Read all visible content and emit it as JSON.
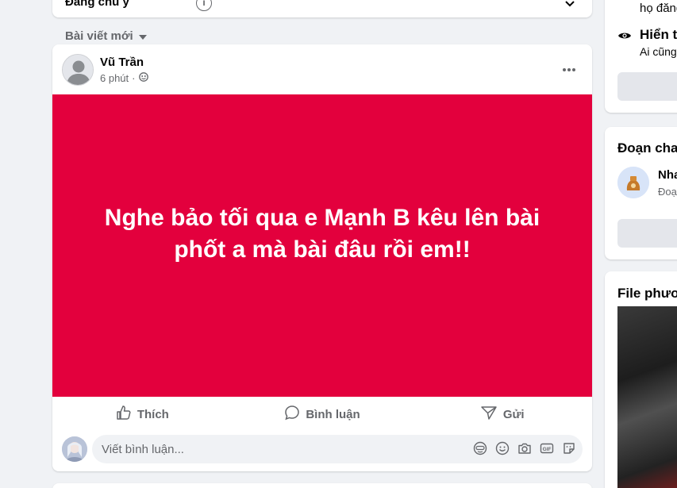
{
  "feed": {
    "top_card_label": "Đáng chú ý",
    "sort_label": "Bài viết mới"
  },
  "post": {
    "author": "Vũ Trần",
    "time": "6 phút",
    "separator": "·",
    "content": "Nghe bảo tối qua e Mạnh B kêu lên bài phốt a mà bài đâu rồi em!!",
    "background_color": "#e3003d",
    "actions": [
      {
        "label": "Thích",
        "icon": "like-icon"
      },
      {
        "label": "Bình luận",
        "icon": "comment-icon"
      },
      {
        "label": "Gửi",
        "icon": "send-icon"
      }
    ],
    "comment_placeholder": "Viết bình luận..."
  },
  "right": {
    "card1": {
      "sub1": "họ đăng",
      "title": "Hiển t",
      "sub2": "Ai cũng"
    },
    "card2": {
      "title": "Đoạn chat",
      "chat_name": "Nha",
      "chat_sub": "Đoạ"
    },
    "card3": {
      "title": "File phươ"
    }
  },
  "colors": {
    "accent": "#1877f2",
    "text_secondary": "#65676b",
    "background": "#f0f2f5"
  }
}
